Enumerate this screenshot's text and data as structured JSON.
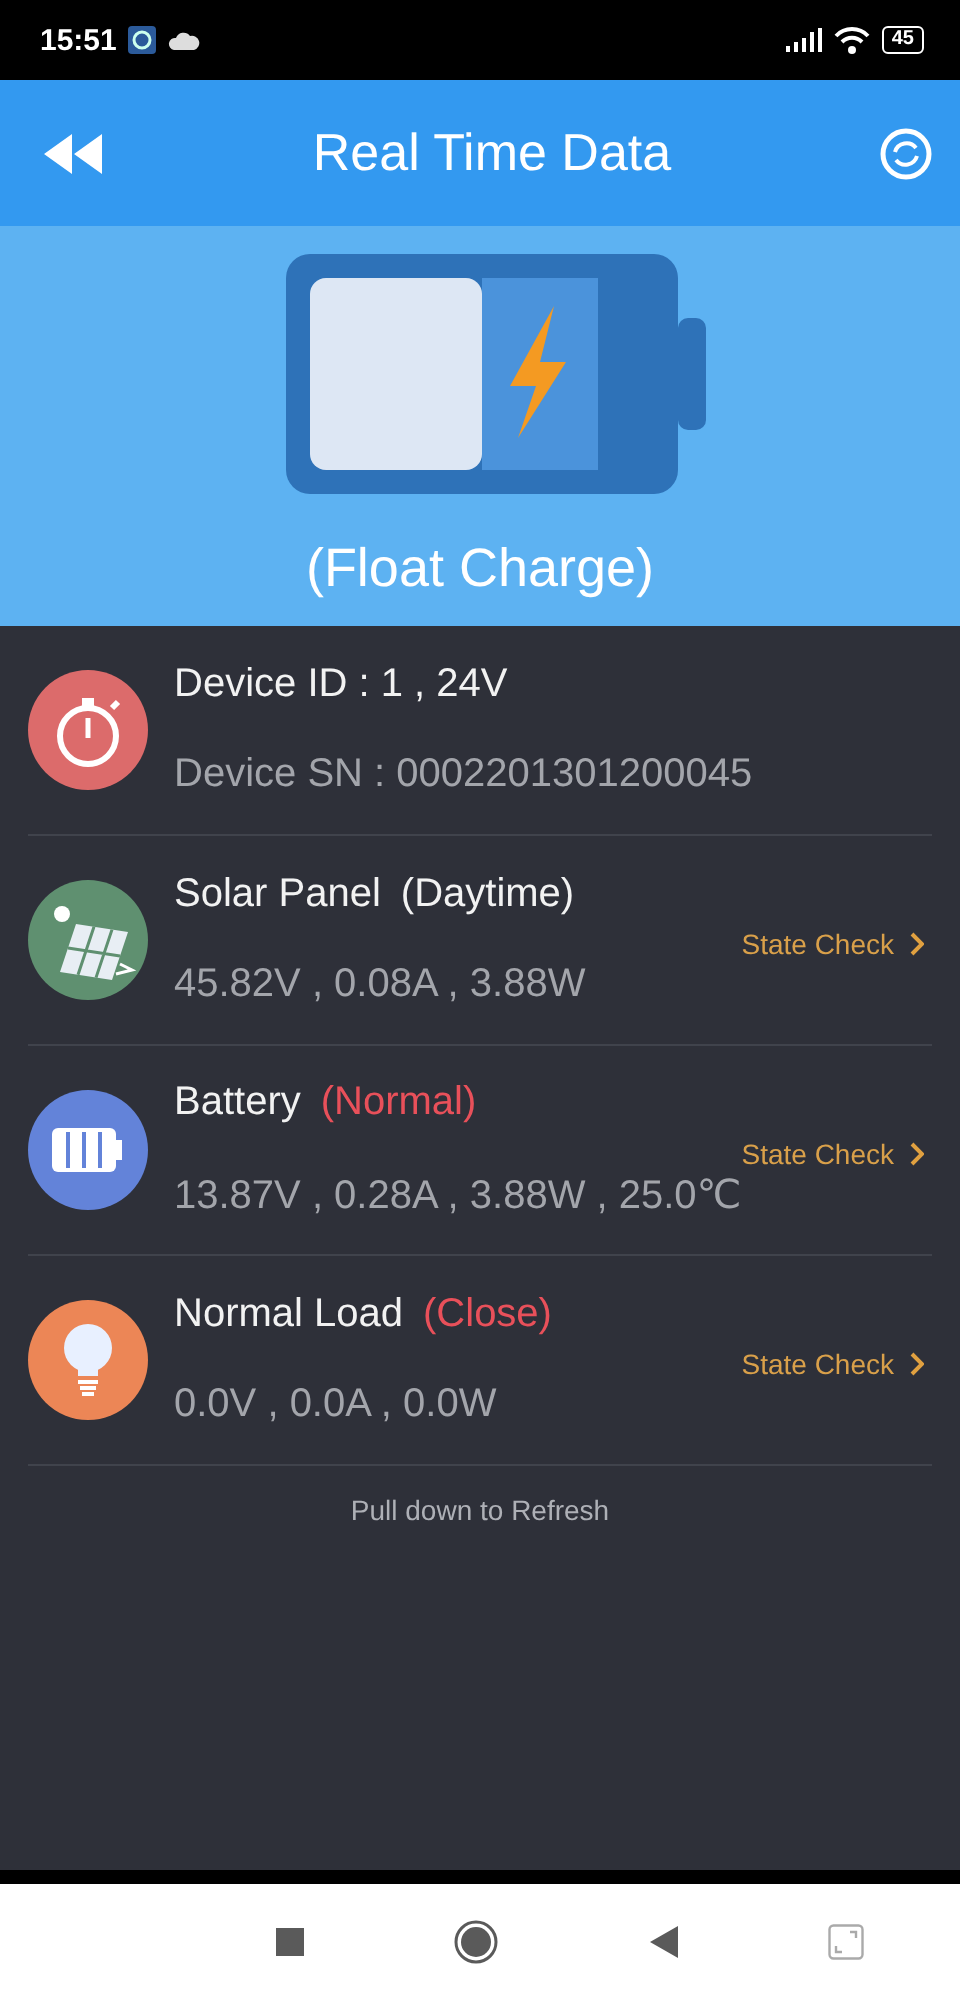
{
  "status_bar": {
    "time": "15:51",
    "battery": "45"
  },
  "header": {
    "title": "Real Time Data"
  },
  "charge_state": "(Float Charge)",
  "device": {
    "id": "Device ID : 1 , 24V",
    "sn": "Device SN : 0002201301200045"
  },
  "items": [
    {
      "kind": "solar",
      "name": "Solar Panel",
      "status": "(Daytime)",
      "alert": false,
      "reading": "45.82V , 0.08A , 3.88W",
      "action": "State Check"
    },
    {
      "kind": "battery",
      "name": "Battery",
      "status": "(Normal)",
      "alert": true,
      "reading": "13.87V , 0.28A , 3.88W , 25.0℃",
      "action": "State Check"
    },
    {
      "kind": "load",
      "name": "Normal Load",
      "status": "(Close)",
      "alert": true,
      "reading": "0.0V , 0.0A , 0.0W",
      "action": "State Check"
    }
  ],
  "footer_hint": "Pull down to Refresh"
}
